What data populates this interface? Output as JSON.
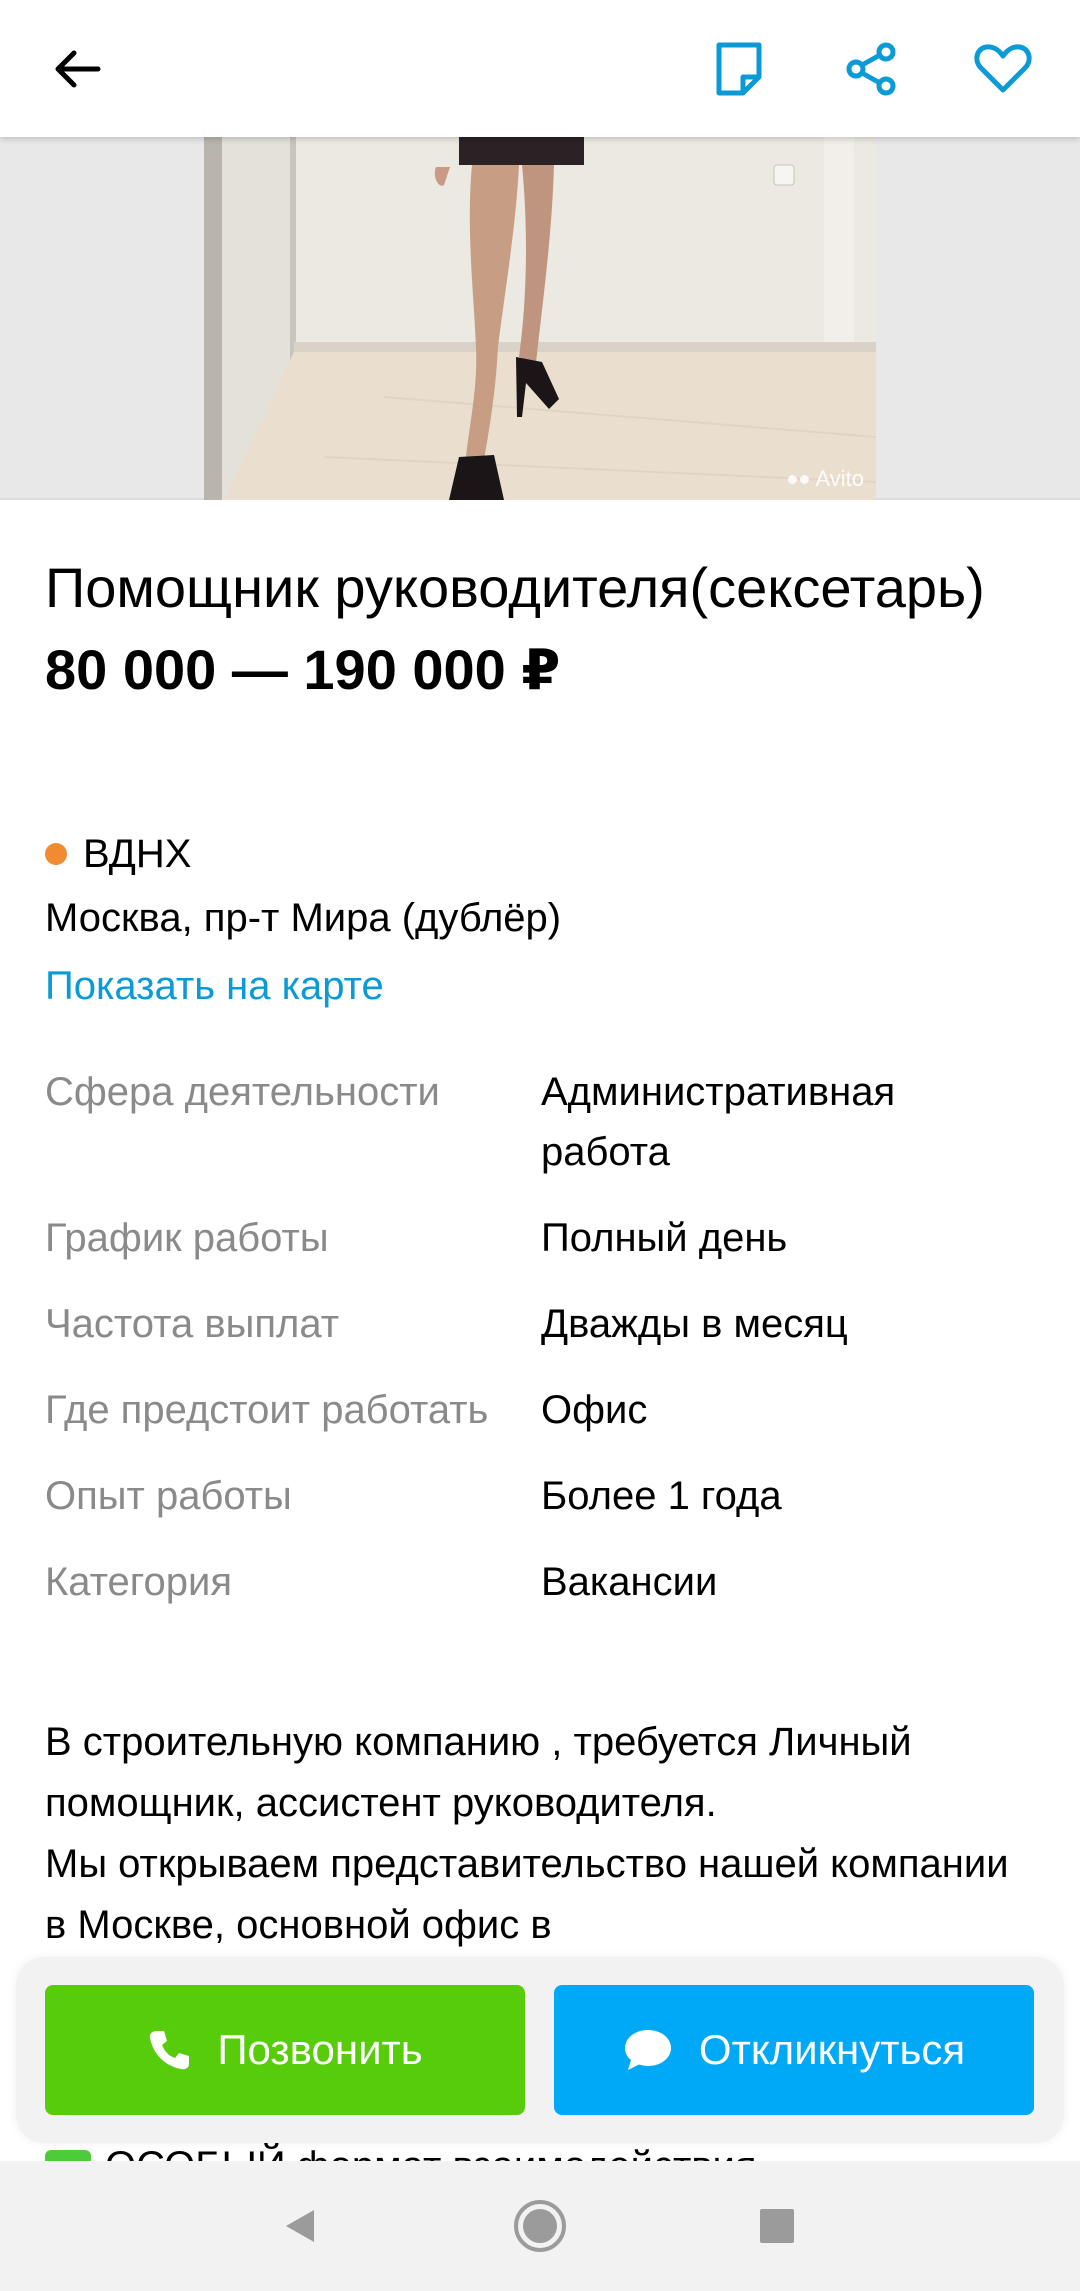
{
  "header": {
    "icons": {
      "back": "arrow-left-icon",
      "note": "note-icon",
      "share": "share-icon",
      "favorite": "heart-icon"
    },
    "accent_color": "#0a9ad6"
  },
  "gallery": {
    "watermark": "Avito"
  },
  "listing": {
    "title": "Помощник руководителя(сексетарь)",
    "price": "80 000 — 190 000 ₽",
    "metro_station": "ВДНХ",
    "metro_color": "#f08b32",
    "address": "Москва, пр-т Мира (дублёр)",
    "map_link": "Показать на карте"
  },
  "params": [
    {
      "label": "Сфера деятельности",
      "value": "Административная работа"
    },
    {
      "label": "График работы",
      "value": "Полный день"
    },
    {
      "label": "Частота выплат",
      "value": "Дважды в месяц"
    },
    {
      "label": "Где предстоит работать",
      "value": "Офис"
    },
    {
      "label": "Опыт работы",
      "value": "Более 1 года"
    },
    {
      "label": "Категория",
      "value": "Вакансии"
    }
  ],
  "description": {
    "paragraph_1": "В строительную компанию , требуется Личный помощник, ассистент руководителя.",
    "paragraph_2": "Мы открываем представительство нашей компании в Москве, основной офис в",
    "partial_line": "ОСОБЫЙ формат взаимодействия"
  },
  "actions": {
    "call_label": "Позвонить",
    "call_color": "#56cc0a",
    "reply_label": "Откликнуться",
    "reply_color": "#00a9f5"
  },
  "system_nav": {
    "icons": [
      "nav-back-icon",
      "nav-home-icon",
      "nav-recent-icon"
    ]
  }
}
